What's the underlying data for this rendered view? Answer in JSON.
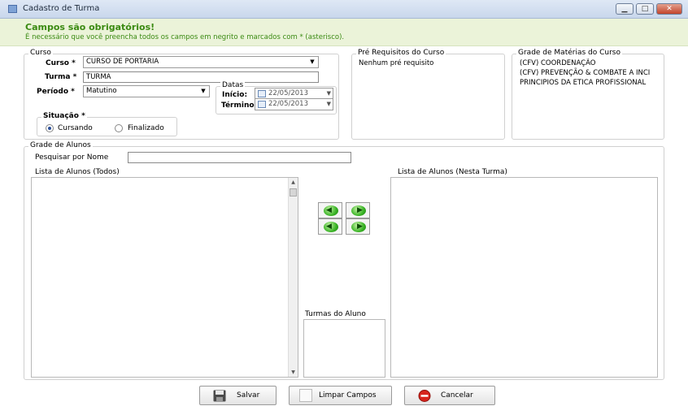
{
  "window": {
    "title": "Cadastro de Turma",
    "minimize": "▁",
    "maximize": "□",
    "close": "✕",
    "icon": "form-icon"
  },
  "banner": {
    "title": "Campos são obrigatórios!",
    "subtitle": "É necessário que você preencha todos os campos em negrito e marcados com * (asterisco)."
  },
  "curso": {
    "group_label": "Curso",
    "curso_label": "Curso *",
    "curso_value": "CURSO DE PORTARIA",
    "turma_label": "Turma *",
    "turma_value": "TURMA",
    "periodo_label": "Período *",
    "periodo_value": "Matutino",
    "datas_label": "Datas",
    "inicio_label": "Início:",
    "inicio_value": "22/05/2013",
    "termino_label": "Término:",
    "termino_value": "22/05/2013",
    "situacao_label": "Situação *",
    "situacao_options": [
      "Cursando",
      "Finalizado"
    ],
    "situacao_selected": "Cursando"
  },
  "prerequisitos": {
    "group_label": "Pré Requisitos do Curso",
    "items": [
      "Nenhum pré requisito"
    ]
  },
  "grade_materias": {
    "group_label": "Grade de Matérias do Curso",
    "items": [
      "(CFV) COORDENAÇÃO",
      "(CFV) PREVENÇÃO & COMBATE A INCI",
      "PRINCIPIOS DA ETICA PROFISSIONAL"
    ]
  },
  "grade_alunos": {
    "group_label": "Grade de Alunos",
    "search_label": "Pesquisar por Nome",
    "search_value": "",
    "all_list_label": "Lista de Alunos (Todos)",
    "class_list_label": "Lista de Alunos (Nesta Turma)",
    "turmas_aluno_label": "Turmas do Aluno",
    "transfer_buttons": [
      "arrow-left-icon",
      "arrow-right-icon",
      "arrow-left-all-icon",
      "arrow-right-all-icon"
    ]
  },
  "footer": {
    "save_label": "Salvar",
    "clear_label": "Limpar Campos",
    "cancel_label": "Cancelar"
  },
  "colors": {
    "banner_bg": "#ebf3d9",
    "banner_text": "#3a8a12",
    "cancel_icon": "#d8241c"
  }
}
